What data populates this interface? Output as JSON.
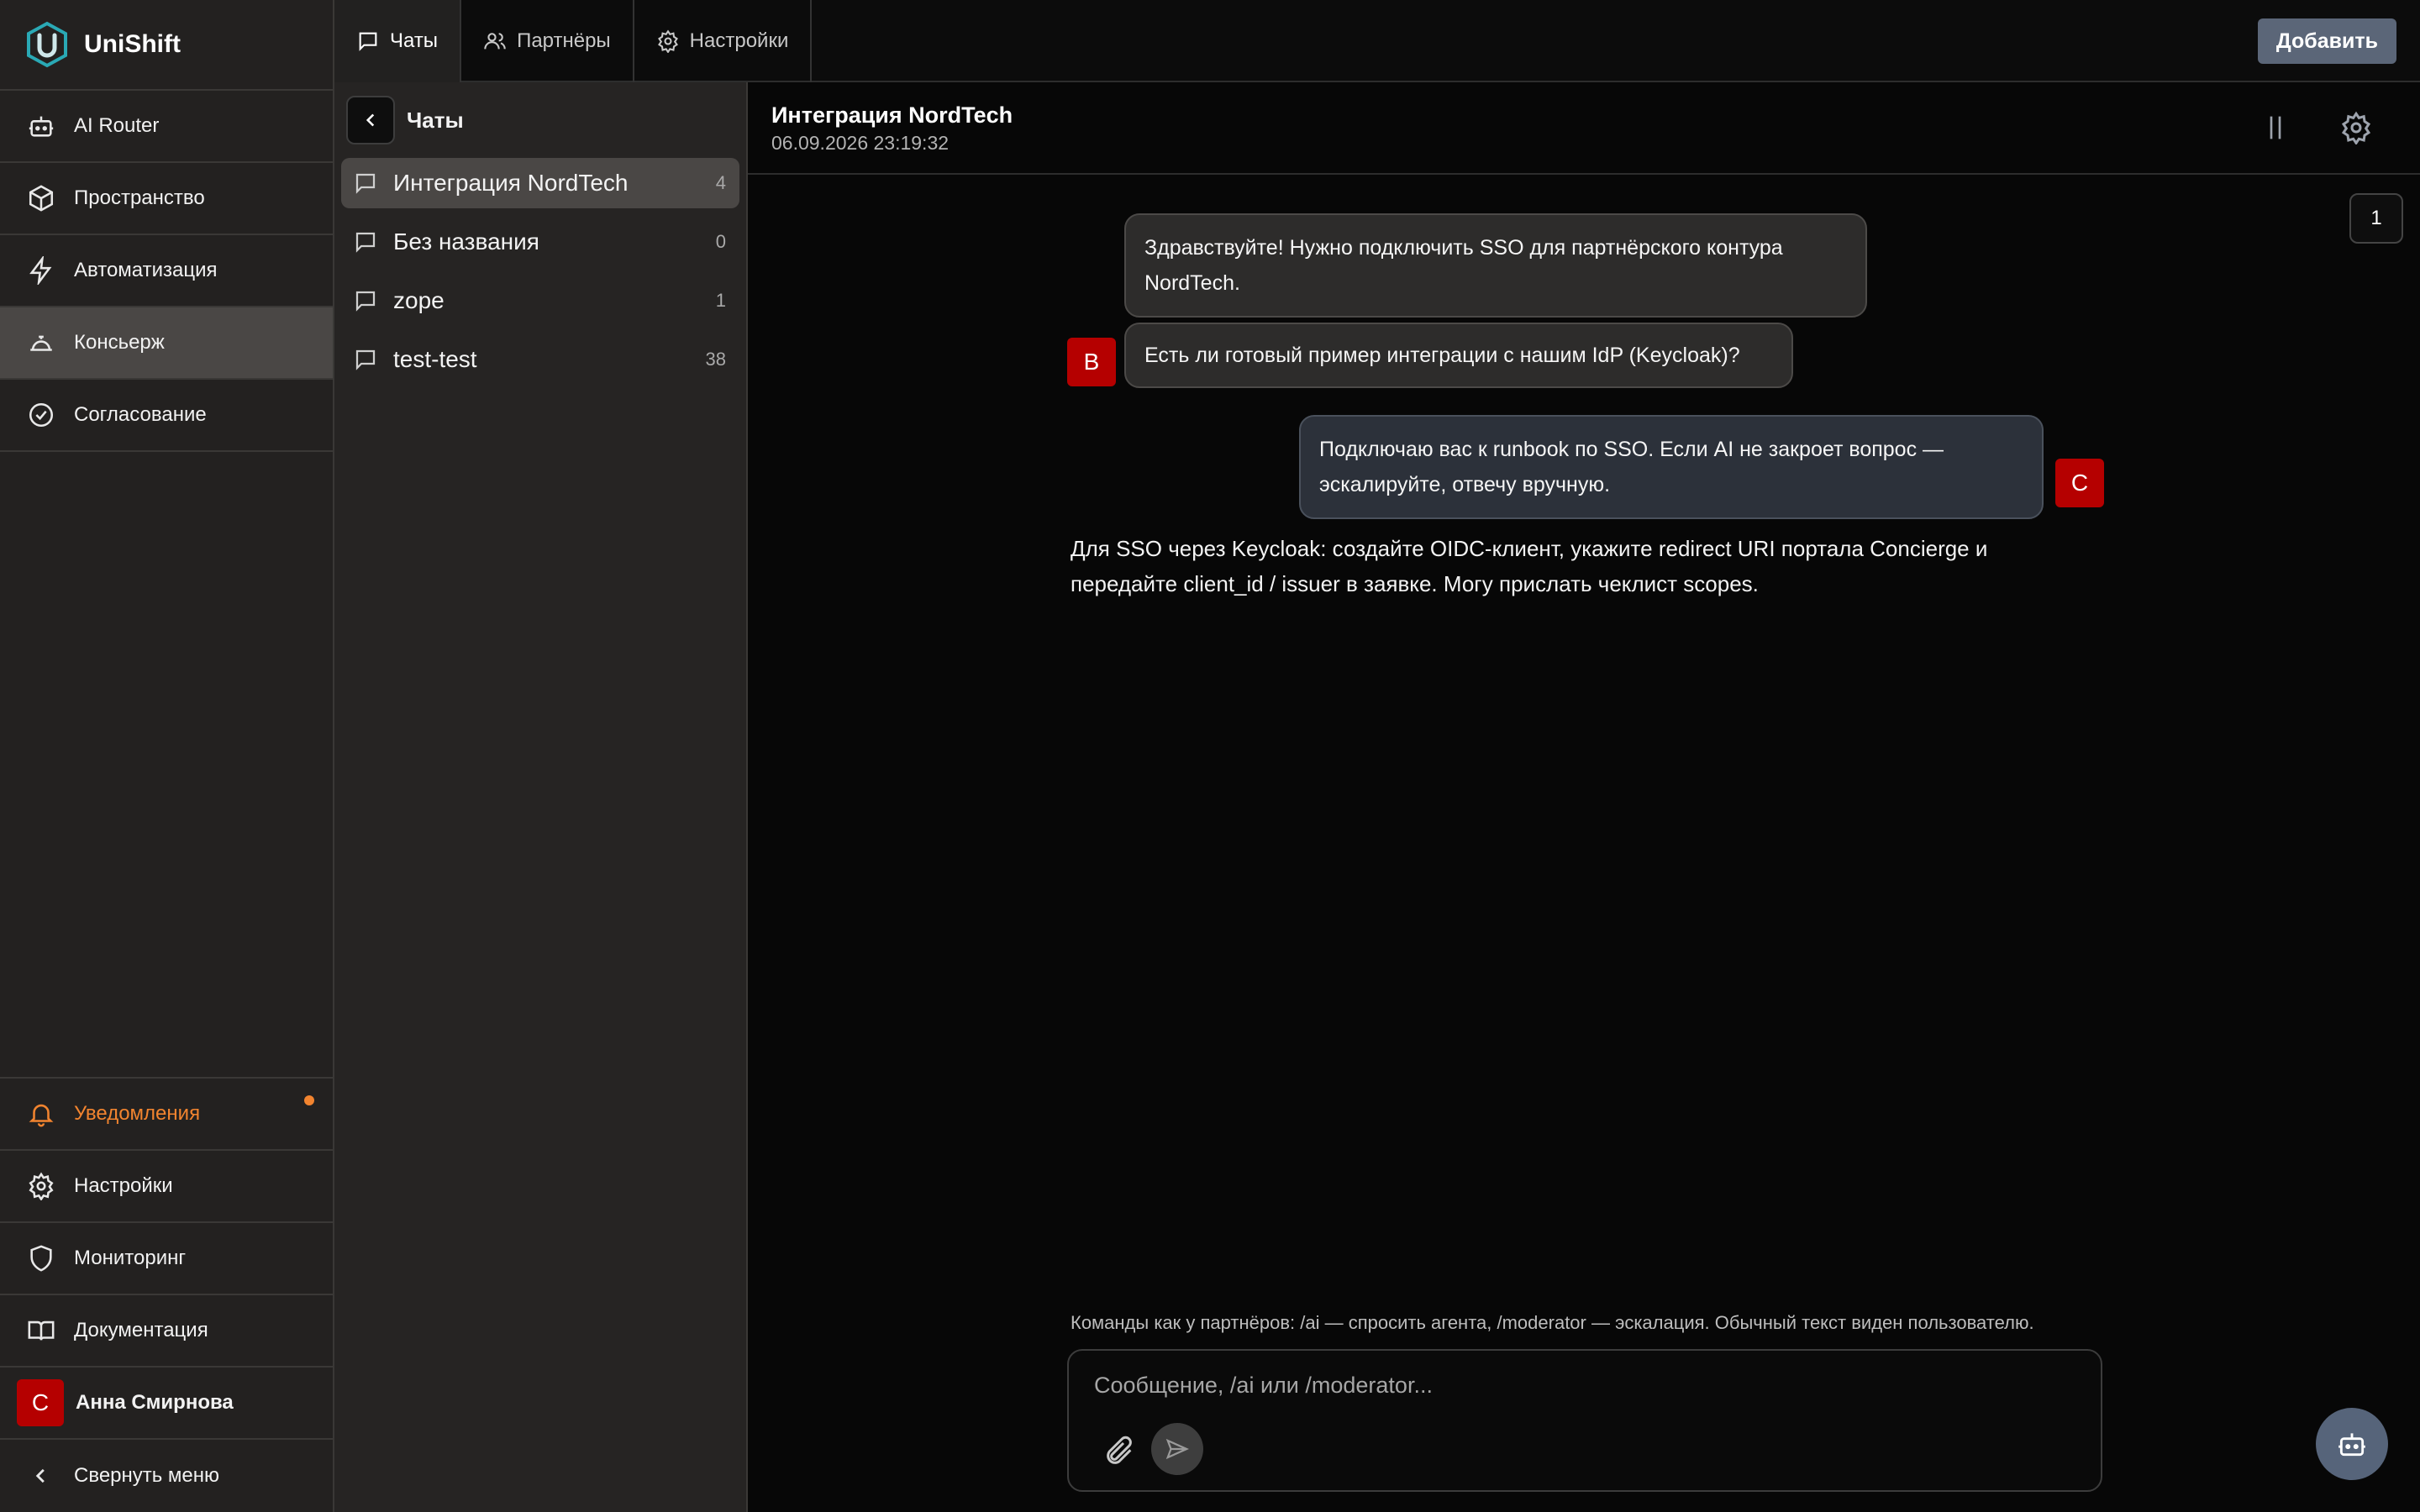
{
  "app": {
    "name": "UniShift"
  },
  "sidebar": {
    "items": [
      {
        "label": "AI Router",
        "icon": "robot-icon"
      },
      {
        "label": "Пространство",
        "icon": "cube-icon"
      },
      {
        "label": "Автоматизация",
        "icon": "lightning-icon"
      },
      {
        "label": "Консьерж",
        "icon": "concierge-bell-icon",
        "active": true
      },
      {
        "label": "Согласование",
        "icon": "check-circle-icon"
      }
    ],
    "bottom": {
      "notifications": "Уведомления",
      "settings": "Настройки",
      "monitoring": "Мониторинг",
      "docs": "Документация",
      "user": {
        "name": "Анна Смирнова",
        "initial": "С"
      },
      "collapse": "Свернуть меню"
    }
  },
  "topbar": {
    "tabs": [
      {
        "label": "Чаты",
        "icon": "chat-icon",
        "active": true
      },
      {
        "label": "Партнёры",
        "icon": "users-icon"
      },
      {
        "label": "Настройки",
        "icon": "gear-icon"
      }
    ],
    "add_button": "Добавить"
  },
  "chatlist": {
    "title": "Чаты",
    "items": [
      {
        "name": "Интеграция NordTech",
        "count": "4",
        "active": true
      },
      {
        "name": "Без названия",
        "count": "0"
      },
      {
        "name": "zope",
        "count": "1"
      },
      {
        "name": "test-test",
        "count": "38"
      }
    ]
  },
  "chat": {
    "title": "Интеграция NordTech",
    "datetime": "06.09.2026 23:19:32",
    "page": "1",
    "messages": [
      {
        "text": "Здравствуйте! Нужно подключить SSO для партнёрского контура NordTech."
      },
      {
        "text": "Есть ли готовый пример интеграции с нашим IdP (Keycloak)?",
        "avatar": "В"
      },
      {
        "text": "Подключаю вас к runbook по SSO. Если AI не закроет вопрос — эскалируйте, отвечу вручную.",
        "avatar": "С"
      },
      {
        "text": "Для SSO через Keycloak: создайте OIDC-клиент, укажите redirect URI портала Concierge и передайте client_id / issuer в заявке. Могу прислать чеклист scopes."
      }
    ],
    "hint": "Команды как у партнёров: /ai — спросить агента, /moderator — эскалация. Обычный текст виден пользователю.",
    "composer": {
      "placeholder": "Сообщение, /ai или /moderator..."
    }
  },
  "colors": {
    "accent_orange": "#f2842f",
    "avatar_red": "#b50000",
    "button_slate": "#5b6678"
  }
}
